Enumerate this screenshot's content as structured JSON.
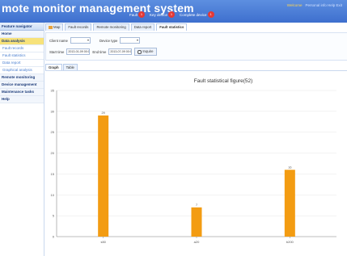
{
  "header": {
    "title": "mote monitor management system",
    "alerts": [
      {
        "label": "Fault",
        "count": "1"
      },
      {
        "label": "Key device",
        "count": "1"
      },
      {
        "label": "Complete device",
        "count": "1"
      }
    ],
    "user": "Welcome",
    "user_extra": "Personal info  Help  Exit"
  },
  "sidebar": {
    "header": "Feature navigator",
    "items": [
      {
        "label": "Home",
        "kind": "section"
      },
      {
        "label": "Data analysis",
        "kind": "section-active"
      },
      {
        "label": "Fault records",
        "kind": "sub"
      },
      {
        "label": "Fault statistics",
        "kind": "sub"
      },
      {
        "label": "Data report",
        "kind": "sub"
      },
      {
        "label": "Graphical analysis",
        "kind": "sub"
      },
      {
        "label": "Remote monitoring",
        "kind": "section"
      },
      {
        "label": "Device management",
        "kind": "section"
      },
      {
        "label": "Maintenance tasks",
        "kind": "section"
      },
      {
        "label": "Help",
        "kind": "section"
      }
    ]
  },
  "tabs": [
    {
      "label": "Map"
    },
    {
      "label": "Fault records"
    },
    {
      "label": "Remote monitoring"
    },
    {
      "label": "Data report"
    },
    {
      "label": "Fault statistics"
    }
  ],
  "filters": {
    "client_label": "Client name",
    "client_value": "",
    "device_type_label": "Device type",
    "device_type_value": "",
    "start_label": "Start time",
    "start_value": "2013-01-09 00:00:00",
    "end_label": "End time",
    "end_value": "2013-07-09 00:00:00",
    "inquire_label": "Inquire"
  },
  "subtabs": [
    {
      "label": "Graph"
    },
    {
      "label": "Table"
    }
  ],
  "chart_data": {
    "type": "bar",
    "title": "Fault statistical figure(52)",
    "categories": [
      "s50",
      "a20",
      "b200"
    ],
    "values": [
      29,
      7,
      16
    ],
    "ylim": [
      0,
      35
    ],
    "yticks": [
      0,
      5,
      10,
      15,
      20,
      25,
      30,
      35
    ],
    "color": "#f39c12",
    "grid": true
  }
}
